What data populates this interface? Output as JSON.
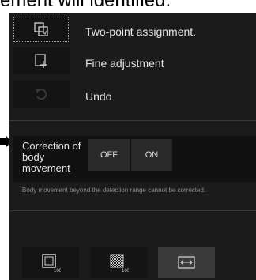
{
  "header": {
    "text": "ement will identified."
  },
  "tools": [
    {
      "label": "Two-point assignment.",
      "icon": "two-point-assignment-icon"
    },
    {
      "label": "Fine adjustment",
      "icon": "fine-adjustment-icon"
    },
    {
      "label": "Undo",
      "icon": "undo-icon"
    }
  ],
  "correction": {
    "label": "Correction of body movement",
    "off_label": "OFF",
    "on_label": "ON",
    "note": "Body movement beyond the detection range cannot be corrected."
  },
  "bottom_buttons": [
    {
      "icon": "fit-view-icon",
      "badge": "100"
    },
    {
      "icon": "grid-pattern-icon",
      "badge": "100"
    },
    {
      "icon": "horizontal-expand-icon",
      "badge": ""
    }
  ],
  "colors": {
    "panel": "#1b1b1b",
    "text": "#e6e6e6",
    "button": "#141414",
    "active": "#3a3a3a"
  }
}
